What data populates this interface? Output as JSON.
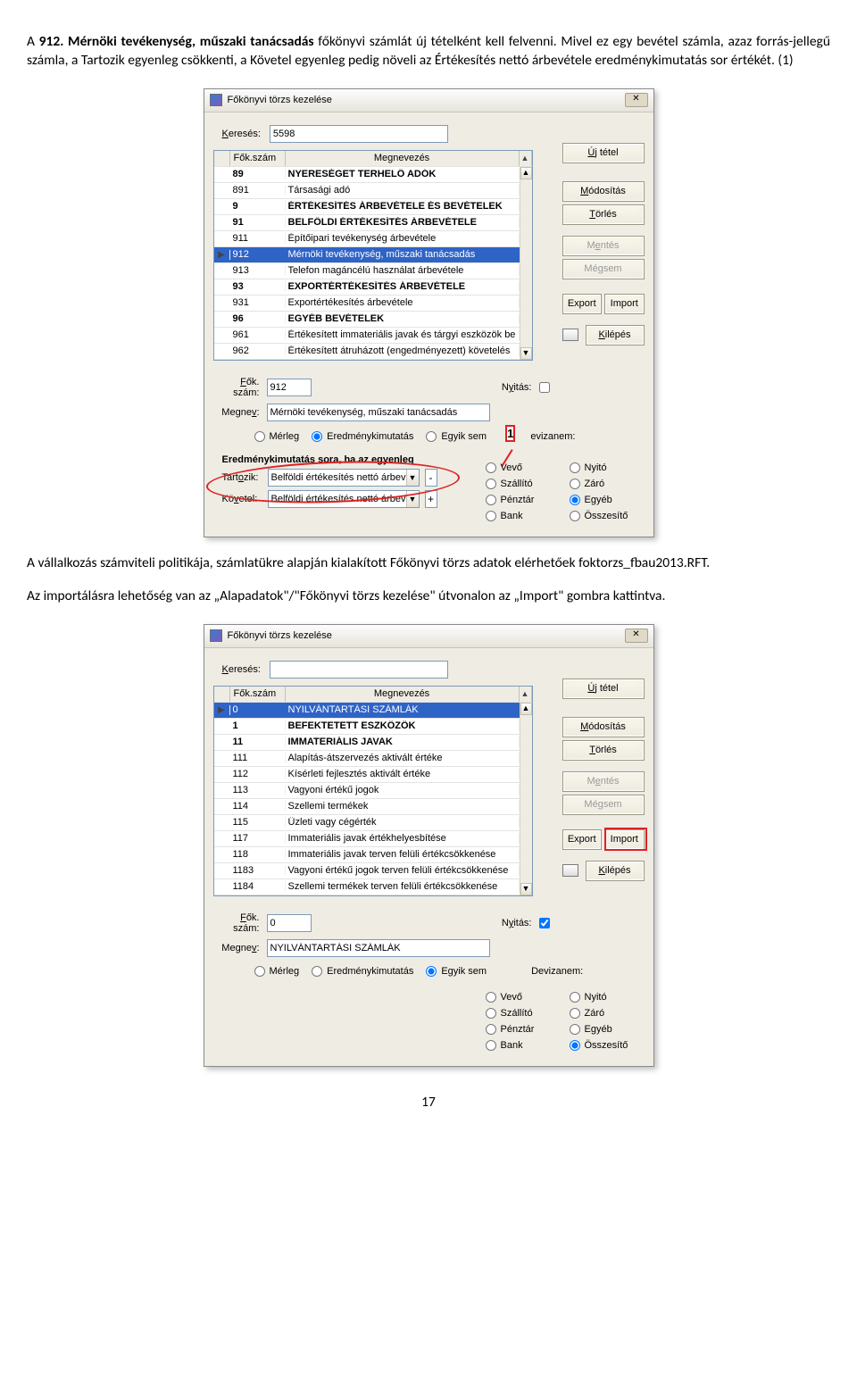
{
  "doc": {
    "para1_a": "A ",
    "para1_bold": "912. Mérnöki tevékenység, műszaki tanácsadás",
    "para1_b": " főkönyvi számlát új tételként kell felvenni. Mivel ez egy bevétel számla, azaz forrás-jellegű számla, a Tartozik egyenleg csökkenti, a Követel egyenleg pedig növeli az Értékesítés nettó árbevétele eredménykimutatás sor értékét. (1)",
    "para2": "A vállalkozás számviteli politikája, számlatükre alapján kialakított Főkönyvi törzs adatok elérhetőek foktorzs_fbau2013.RFT.",
    "para3": "Az importálásra lehetőség van az „Alapadatok\"/\"Főkönyvi törzs kezelése\" útvonalon az „Import\" gombra kattintva.",
    "page": "17"
  },
  "dialog1": {
    "title": "Főkönyvi törzs kezelése",
    "search": {
      "label": "Keresés:",
      "value": "5598"
    },
    "buttons": {
      "new": "Új tétel",
      "edit": "Módosítás",
      "del": "Törlés",
      "save": "Mentés",
      "cancel": "Mégsem",
      "export": "Export",
      "import": "Import",
      "exit": "Kilépés"
    },
    "head": {
      "c1": "Fők.szám",
      "c2": "Megnevezés"
    },
    "rows": [
      {
        "n": "89",
        "m": "NYERESÉGET TERHELŐ ADÓK",
        "bold": true
      },
      {
        "n": "891",
        "m": "Társasági adó"
      },
      {
        "n": "9",
        "m": "ÉRTÉKESÍTÉS ÁRBEVÉTELE ÉS BEVÉTELEK",
        "bold": true
      },
      {
        "n": "91",
        "m": "BELFÖLDI ÉRTÉKESÍTÉS ÁRBEVÉTELE",
        "bold": true
      },
      {
        "n": "911",
        "m": "Építőipari tevékenység árbevétele"
      },
      {
        "n": "912",
        "m": "Mérnöki tevékenység, műszaki tanácsadás",
        "sel": true,
        "mark": true
      },
      {
        "n": "913",
        "m": "Telefon magáncélú használat árbevétele"
      },
      {
        "n": "93",
        "m": "EXPORTÉRTÉKESÍTÉS ÁRBEVÉTELE",
        "bold": true
      },
      {
        "n": "931",
        "m": "Exportértékesítés árbevétele"
      },
      {
        "n": "96",
        "m": "EGYÉB BEVÉTELEK",
        "bold": true
      },
      {
        "n": "961",
        "m": "Értékesített immateriális javak és tárgyi eszközök be"
      },
      {
        "n": "962",
        "m": "Értékesített átruházott (engedményezett) követelés"
      }
    ],
    "form": {
      "fokszam": {
        "label": "Fők. szám:",
        "value": "912"
      },
      "nyitas": {
        "label": "Nyitás:"
      },
      "megnev": {
        "label": "Megnev:",
        "value": "Mérnöki tevékenység, műszaki tanácsadás"
      },
      "radios": [
        "Mérleg",
        "Eredménykimutatás",
        "Egyik sem"
      ],
      "radio_sel": 1,
      "dnem": {
        "marker": "1",
        "label": "evizanem:"
      },
      "erktitle": "Eredménykimutatás sora, ha az egyenleg",
      "tartozik": {
        "label": "Tartozik:",
        "value": "Belföldi értékesítés nettó árbevétele",
        "sign": "-"
      },
      "kovetel": {
        "label": "Követel:",
        "value": "Belföldi értékesítés nettó árbevétele",
        "sign": "+"
      },
      "radioGrid": [
        [
          "Vevő",
          "Nyitó"
        ],
        [
          "Szállító",
          "Záró"
        ],
        [
          "Pénztár",
          "Egyéb"
        ],
        [
          "Bank",
          "Összesítő"
        ]
      ],
      "radioGrid_checked": "Egyéb"
    }
  },
  "dialog2": {
    "title": "Főkönyvi törzs kezelése",
    "search": {
      "label": "Keresés:",
      "value": ""
    },
    "buttons": {
      "new": "Új tétel",
      "edit": "Módosítás",
      "del": "Törlés",
      "save": "Mentés",
      "cancel": "Mégsem",
      "export": "Export",
      "import": "Import",
      "exit": "Kilépés"
    },
    "head": {
      "c1": "Fők.szám",
      "c2": "Megnevezés"
    },
    "rows": [
      {
        "n": "0",
        "m": "NYILVÁNTARTÁSI SZÁMLÁK",
        "sel": true,
        "mark": true
      },
      {
        "n": "1",
        "m": "BEFEKTETETT ESZKÖZÖK",
        "bold": true
      },
      {
        "n": "11",
        "m": "IMMATERIÁLIS JAVAK",
        "bold": true
      },
      {
        "n": "111",
        "m": "Alapítás-átszervezés aktivált értéke"
      },
      {
        "n": "112",
        "m": "Kísérleti fejlesztés aktivált értéke"
      },
      {
        "n": "113",
        "m": "Vagyoni értékű jogok"
      },
      {
        "n": "114",
        "m": "Szellemi termékek"
      },
      {
        "n": "115",
        "m": "Üzleti vagy cégérték"
      },
      {
        "n": "117",
        "m": "Immateriális javak értékhelyesbítése"
      },
      {
        "n": "118",
        "m": "Immateriális javak terven felüli értékcsökkenése"
      },
      {
        "n": "1183",
        "m": "Vagyoni értékű jogok terven felüli értékcsökkenése"
      },
      {
        "n": "1184",
        "m": "Szellemi termékek terven felüli értékcsökkenése"
      }
    ],
    "form": {
      "fokszam": {
        "label": "Fők. szám:",
        "value": "0"
      },
      "nyitas": {
        "label": "Nyitás:",
        "checked": true
      },
      "megnev": {
        "label": "Megnev:",
        "value": "NYILVÁNTARTÁSI SZÁMLÁK"
      },
      "radios": [
        "Mérleg",
        "Eredménykimutatás",
        "Egyik sem"
      ],
      "radio_sel": 2,
      "dnem": {
        "label": "Devizanem:"
      },
      "radioGrid": [
        [
          "Vevő",
          "Nyitó"
        ],
        [
          "Szállító",
          "Záró"
        ],
        [
          "Pénztár",
          "Egyéb"
        ],
        [
          "Bank",
          "Összesítő"
        ]
      ],
      "radioGrid_checked": "Összesítő"
    }
  }
}
